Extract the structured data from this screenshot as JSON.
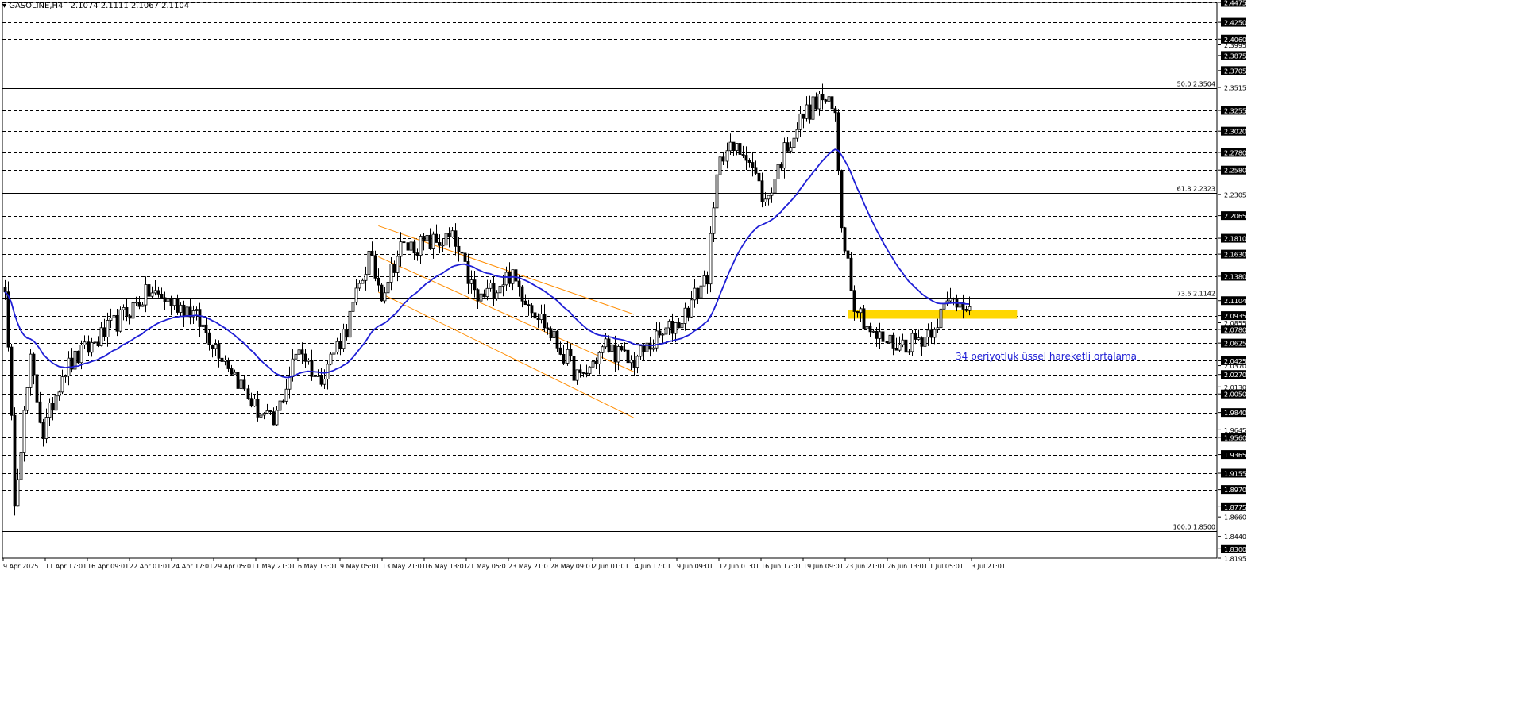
{
  "header": {
    "symbol": "GASOLINE,H4",
    "ohlc": "2.1074 2.1111 2.1067 2.1104"
  },
  "colors": {
    "background": "#ffffff",
    "grid": "#000000",
    "bull_candle": "#ffffff",
    "bear_candle": "#000000",
    "ema": "#1f1fd6",
    "channel": "#ff8c00",
    "zone": "#ffd700",
    "annotation": "#1f1fd6",
    "price_label_bg": "#000000",
    "price_label_text": "#ffffff"
  },
  "chart_data": {
    "type": "candlestick",
    "timeframe": "H4",
    "ylim": [
      1.8195,
      2.4475
    ],
    "price_axis_labels": [
      {
        "value": 2.4475,
        "highlight": true
      },
      {
        "value": 2.425,
        "highlight": true
      },
      {
        "value": 2.406,
        "highlight": true
      },
      {
        "value": 2.3995,
        "highlight": false
      },
      {
        "value": 2.3875,
        "highlight": true
      },
      {
        "value": 2.3705,
        "highlight": true
      },
      {
        "value": 2.3515,
        "highlight": false
      },
      {
        "value": 2.3255,
        "highlight": true
      },
      {
        "value": 2.302,
        "highlight": true
      },
      {
        "value": 2.278,
        "highlight": true
      },
      {
        "value": 2.258,
        "highlight": true
      },
      {
        "value": 2.2305,
        "highlight": false
      },
      {
        "value": 2.2065,
        "highlight": true
      },
      {
        "value": 2.181,
        "highlight": true
      },
      {
        "value": 2.163,
        "highlight": true
      },
      {
        "value": 2.138,
        "highlight": true
      },
      {
        "value": 2.1104,
        "highlight": true
      },
      {
        "value": 2.0935,
        "highlight": true
      },
      {
        "value": 2.0855,
        "highlight": false
      },
      {
        "value": 2.078,
        "highlight": true
      },
      {
        "value": 2.0625,
        "highlight": true
      },
      {
        "value": 2.0425,
        "highlight": true
      },
      {
        "value": 2.037,
        "highlight": false
      },
      {
        "value": 2.027,
        "highlight": true
      },
      {
        "value": 2.013,
        "highlight": false
      },
      {
        "value": 2.005,
        "highlight": true
      },
      {
        "value": 1.984,
        "highlight": true
      },
      {
        "value": 1.9645,
        "highlight": false
      },
      {
        "value": 1.956,
        "highlight": true
      },
      {
        "value": 1.9365,
        "highlight": true
      },
      {
        "value": 1.9155,
        "highlight": true
      },
      {
        "value": 1.897,
        "highlight": true
      },
      {
        "value": 1.8775,
        "highlight": true
      },
      {
        "value": 1.866,
        "highlight": false
      },
      {
        "value": 1.844,
        "highlight": false
      },
      {
        "value": 1.83,
        "highlight": true
      },
      {
        "value": 1.8195,
        "highlight": false
      }
    ],
    "dashed_levels": [
      2.4475,
      2.425,
      2.406,
      2.3875,
      2.3705,
      2.3255,
      2.302,
      2.278,
      2.258,
      2.2065,
      2.181,
      2.163,
      2.138,
      2.0935,
      2.078,
      2.0625,
      2.0425,
      2.027,
      2.005,
      1.984,
      1.956,
      1.9365,
      1.9155,
      1.897,
      1.8775,
      1.83
    ],
    "fibonacci_levels": [
      {
        "label": "50.0 2.3504",
        "value": 2.3504
      },
      {
        "label": "61.8 2.2323",
        "value": 2.2323
      },
      {
        "label": "73.6 2.1142",
        "value": 2.1142
      },
      {
        "label": "100.0 1.8500",
        "value": 1.85
      }
    ],
    "time_labels": [
      "9 Apr 2025",
      "11 Apr 17:01",
      "16 Apr 09:01",
      "22 Apr 01:01",
      "24 Apr 17:01",
      "29 Apr 05:01",
      "1 May 21:01",
      "6 May 13:01",
      "9 May 05:01",
      "13 May 21:01",
      "16 May 13:01",
      "21 May 05:01",
      "23 May 21:01",
      "28 May 09:01",
      "2 Jun 01:01",
      "4 Jun 17:01",
      "9 Jun 09:01",
      "12 Jun 01:01",
      "16 Jun 17:01",
      "19 Jun 09:01",
      "23 Jun 21:01",
      "26 Jun 13:01",
      "1 Jul 05:01",
      "3 Jul 21:01"
    ],
    "anchors": [
      {
        "i": 0,
        "price": 2.13
      },
      {
        "i": 3,
        "price": 1.89
      },
      {
        "i": 8,
        "price": 2.04
      },
      {
        "i": 12,
        "price": 1.96
      },
      {
        "i": 18,
        "price": 2.03
      },
      {
        "i": 30,
        "price": 2.07
      },
      {
        "i": 45,
        "price": 2.12
      },
      {
        "i": 58,
        "price": 2.1
      },
      {
        "i": 70,
        "price": 2.04
      },
      {
        "i": 78,
        "price": 1.99
      },
      {
        "i": 84,
        "price": 1.97
      },
      {
        "i": 92,
        "price": 2.06
      },
      {
        "i": 98,
        "price": 2.02
      },
      {
        "i": 107,
        "price": 2.08
      },
      {
        "i": 114,
        "price": 2.16
      },
      {
        "i": 118,
        "price": 2.12
      },
      {
        "i": 124,
        "price": 2.17
      },
      {
        "i": 140,
        "price": 2.18
      },
      {
        "i": 148,
        "price": 2.11
      },
      {
        "i": 158,
        "price": 2.14
      },
      {
        "i": 168,
        "price": 2.09
      },
      {
        "i": 180,
        "price": 2.02
      },
      {
        "i": 188,
        "price": 2.06
      },
      {
        "i": 196,
        "price": 2.04
      },
      {
        "i": 202,
        "price": 2.06
      },
      {
        "i": 212,
        "price": 2.09
      },
      {
        "i": 220,
        "price": 2.14
      },
      {
        "i": 224,
        "price": 2.28
      },
      {
        "i": 232,
        "price": 2.28
      },
      {
        "i": 238,
        "price": 2.22
      },
      {
        "i": 244,
        "price": 2.28
      },
      {
        "i": 250,
        "price": 2.32
      },
      {
        "i": 256,
        "price": 2.34
      },
      {
        "i": 260,
        "price": 2.32
      },
      {
        "i": 262,
        "price": 2.2
      },
      {
        "i": 266,
        "price": 2.11
      },
      {
        "i": 272,
        "price": 2.07
      },
      {
        "i": 280,
        "price": 2.06
      },
      {
        "i": 288,
        "price": 2.07
      },
      {
        "i": 296,
        "price": 2.11
      },
      {
        "i": 302,
        "price": 2.11
      }
    ],
    "candle_count": 303,
    "ema": {
      "period": 34,
      "color": "#1f1fd6"
    },
    "channel_lines": [
      {
        "from": {
          "i": 117,
          "price": 2.195
        },
        "to": {
          "i": 197,
          "price": 2.095
        }
      },
      {
        "from": {
          "i": 117,
          "price": 2.16
        },
        "to": {
          "i": 197,
          "price": 2.03
        }
      },
      {
        "from": {
          "i": 117,
          "price": 2.12
        },
        "to": {
          "i": 197,
          "price": 1.978
        }
      }
    ],
    "zone": {
      "from_i": 264,
      "to_i": 317,
      "top": 2.1,
      "bottom": 2.09
    },
    "annotation": "34 periyotluk üssel hareketli ortalama"
  }
}
